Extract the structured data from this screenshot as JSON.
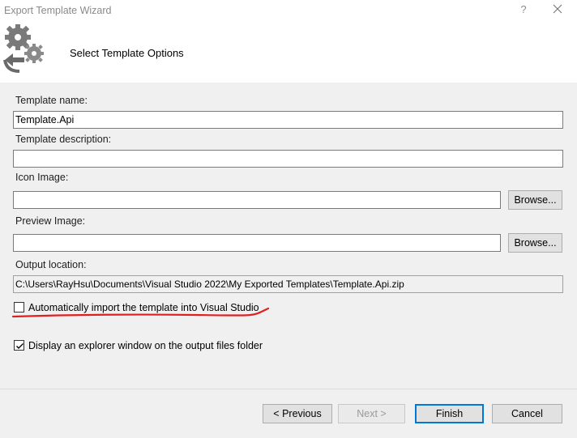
{
  "window": {
    "title": "Export Template Wizard",
    "help_glyph": "?"
  },
  "header": {
    "heading": "Select Template Options"
  },
  "form": {
    "template_name_label": "Template name:",
    "template_name_value": "Template.Api",
    "template_description_label": "Template description:",
    "template_description_value": "",
    "icon_image_label": "Icon Image:",
    "icon_image_value": "",
    "icon_browse_label": "Browse...",
    "preview_image_label": "Preview Image:",
    "preview_image_value": "",
    "preview_browse_label": "Browse...",
    "output_location_label": "Output location:",
    "output_location_value": "C:\\Users\\RayHsu\\Documents\\Visual Studio 2022\\My Exported Templates\\Template.Api.zip"
  },
  "options": {
    "auto_import_label": "Automatically import the template into Visual Studio",
    "auto_import_checked": false,
    "display_explorer_label": "Display an explorer window on the output files folder",
    "display_explorer_checked": true
  },
  "footer": {
    "previous_label": "< Previous",
    "next_label": "Next >",
    "finish_label": "Finish",
    "cancel_label": "Cancel"
  },
  "colors": {
    "panel_bg": "#f0f0f0",
    "accent": "#0078d7",
    "annotation_red": "#e02020"
  }
}
